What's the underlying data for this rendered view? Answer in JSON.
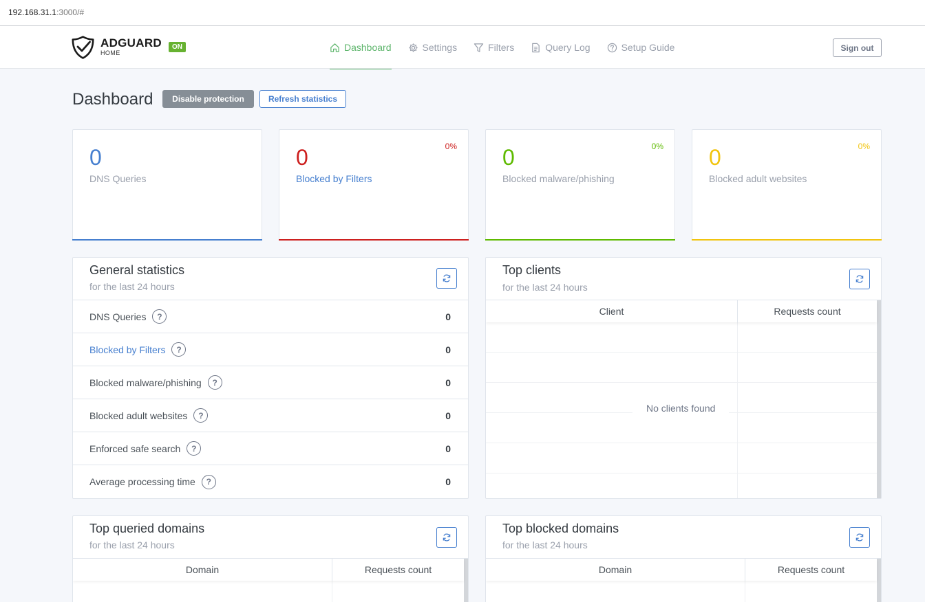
{
  "browser": {
    "url_host": "192.168.31.1",
    "url_rest": ":3000/#"
  },
  "header": {
    "logo_title": "ADGUARD",
    "logo_sub": "HOME",
    "status_badge": "ON",
    "nav": [
      {
        "label": "Dashboard",
        "icon": "home-icon",
        "active": true
      },
      {
        "label": "Settings",
        "icon": "gear-icon"
      },
      {
        "label": "Filters",
        "icon": "filter-icon"
      },
      {
        "label": "Query Log",
        "icon": "document-icon"
      },
      {
        "label": "Setup Guide",
        "icon": "help-circle-icon"
      }
    ],
    "signout_label": "Sign out"
  },
  "page": {
    "title": "Dashboard",
    "disable_label": "Disable protection",
    "refresh_label": "Refresh statistics"
  },
  "stats": [
    {
      "value": "0",
      "label": "DNS Queries",
      "percent": "",
      "color": "#467fcf"
    },
    {
      "value": "0",
      "label": "Blocked by Filters",
      "percent": "0%",
      "color": "#cd201f"
    },
    {
      "value": "0",
      "label": "Blocked malware/phishing",
      "percent": "0%",
      "color": "#5eba00"
    },
    {
      "value": "0",
      "label": "Blocked adult websites",
      "percent": "0%",
      "color": "#f1c40f"
    }
  ],
  "general_stats": {
    "title": "General statistics",
    "subtitle": "for the last 24 hours",
    "rows": [
      {
        "label": "DNS Queries",
        "value": "0"
      },
      {
        "label": "Blocked by Filters",
        "value": "0"
      },
      {
        "label": "Blocked malware/phishing",
        "value": "0"
      },
      {
        "label": "Blocked adult websites",
        "value": "0"
      },
      {
        "label": "Enforced safe search",
        "value": "0"
      },
      {
        "label": "Average processing time",
        "value": "0"
      }
    ]
  },
  "top_clients": {
    "title": "Top clients",
    "subtitle": "for the last 24 hours",
    "col1": "Client",
    "col2": "Requests count",
    "empty": "No clients found"
  },
  "top_queried": {
    "title": "Top queried domains",
    "subtitle": "for the last 24 hours",
    "col1": "Domain",
    "col2": "Requests count"
  },
  "top_blocked": {
    "title": "Top blocked domains",
    "subtitle": "for the last 24 hours",
    "col1": "Domain",
    "col2": "Requests count"
  }
}
